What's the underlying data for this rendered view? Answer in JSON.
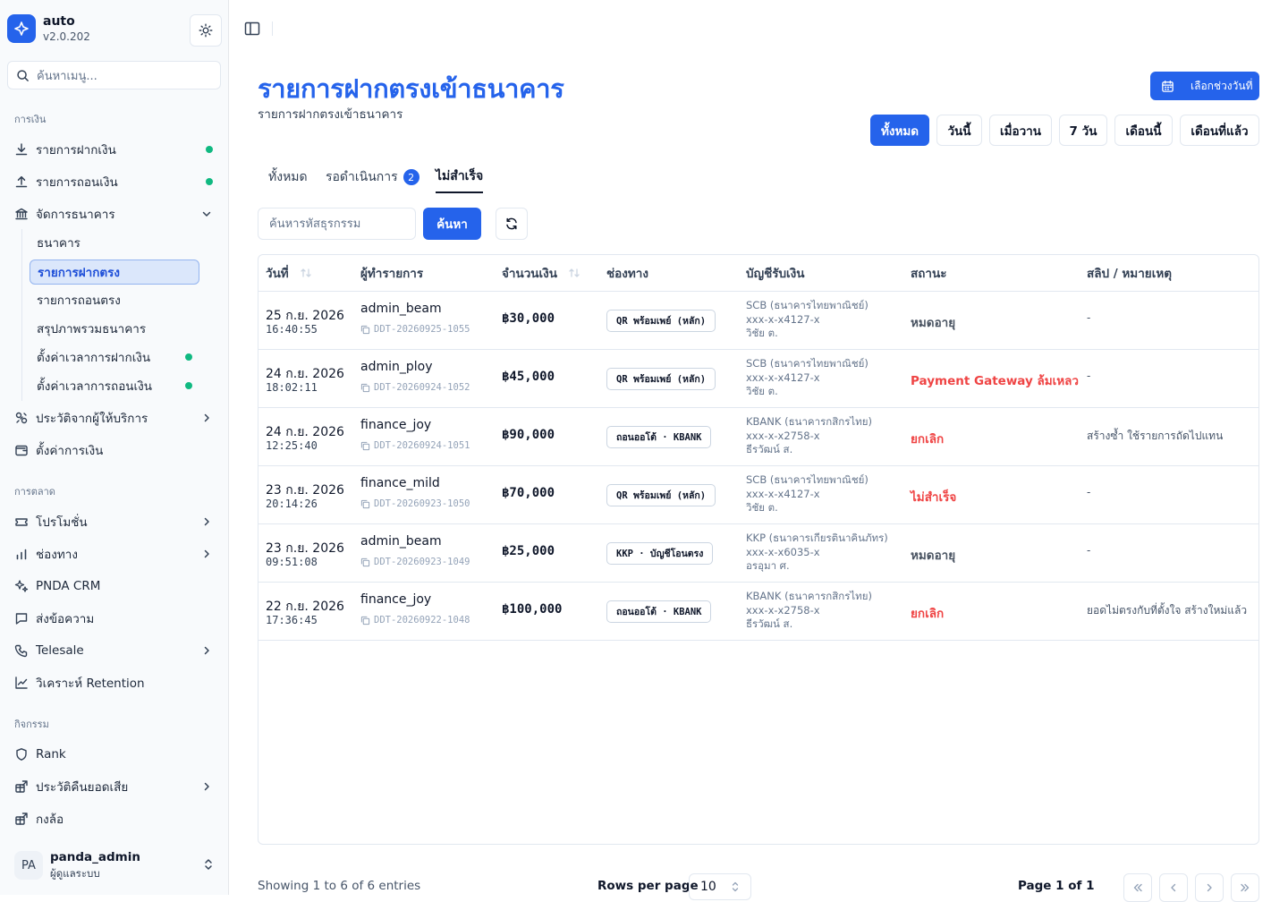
{
  "app": {
    "name": "auto",
    "version": "v2.0.202"
  },
  "sidebar": {
    "search_placeholder": "ค้นหาเมนู...",
    "groups": {
      "finance": "การเงิน",
      "marketing": "การตลาด",
      "activity": "กิจกรรม"
    },
    "items": {
      "deposit": "รายการฝากเงิน",
      "withdraw": "รายการถอนเงิน",
      "bank_mgmt": "จัดการธนาคาร",
      "provider_history": "ประวัติจากผู้ให้บริการ",
      "finance_settings": "ตั้งค่าการเงิน",
      "promotion": "โปรโมชั่น",
      "channel": "ช่องทาง",
      "crm": "PNDA CRM",
      "message": "ส่งข้อความ",
      "telesale": "Telesale",
      "retention": "วิเคราะห์ Retention",
      "rank": "Rank",
      "cashback": "ประวัติคืนยอดเสีย",
      "box": "กงล้อ"
    },
    "bank_sub": {
      "bank": "ธนาคาร",
      "direct_deposit": "รายการฝากตรง",
      "direct_withdraw": "รายการถอนตรง",
      "bank_summary": "สรุปภาพรวมธนาคาร",
      "deposit_time": "ตั้งค่าเวลาการฝากเงิน",
      "withdraw_time": "ตั้งค่าเวลาการถอนเงิน"
    },
    "status_color": "#10b981"
  },
  "user": {
    "initials": "PA",
    "name": "panda_admin",
    "role": "ผู้ดูแลระบบ"
  },
  "page": {
    "title": "รายการฝากตรงเข้าธนาคาร",
    "subtitle": "รายการฝากตรงเข้าธนาคาร",
    "date_button": "เลือกช่วงวันที่",
    "ranges": [
      "ทั้งหมด",
      "วันนี้",
      "เมื่อวาน",
      "7 วัน",
      "เดือนนี้",
      "เดือนที่แล้ว"
    ],
    "active_range": "ทั้งหมด",
    "tabs": [
      {
        "label": "ทั้งหมด"
      },
      {
        "label": "รอดำเนินการ",
        "badge": "2"
      },
      {
        "label": "ไม่สำเร็จ"
      }
    ],
    "active_tab": "ไม่สำเร็จ",
    "search_placeholder": "ค้นหารหัสธุรกรรม",
    "search_button": "ค้นหา",
    "accent": "#2563eb"
  },
  "table": {
    "columns": [
      "วันที่",
      "ผู้ทำรายการ",
      "จำนวนเงิน",
      "ช่องทาง",
      "บัญชีรับเงิน",
      "สถานะ",
      "สลิป / หมายเหตุ"
    ],
    "rows": [
      {
        "date": "25 ก.ย. 2026",
        "time": "16:40:55",
        "user": "admin_beam",
        "ref": "DDT-20260925-1055",
        "amount": "฿30,000",
        "channel": "QR พร้อมเพย์ (หลัก)",
        "acc_bank": "SCB (ธนาคารไทยพาณิชย์)",
        "acc_no": "xxx-x-x4127-x",
        "acc_name": "วิชัย ต.",
        "status": "หมดอายุ",
        "status_color": "#4b5563",
        "note": "-"
      },
      {
        "date": "24 ก.ย. 2026",
        "time": "18:02:11",
        "user": "admin_ploy",
        "ref": "DDT-20260924-1052",
        "amount": "฿45,000",
        "channel": "QR พร้อมเพย์ (หลัก)",
        "acc_bank": "SCB (ธนาคารไทยพาณิชย์)",
        "acc_no": "xxx-x-x4127-x",
        "acc_name": "วิชัย ต.",
        "status": "Payment Gateway ล้มเหลว",
        "status_color": "#ef4444",
        "note": "-"
      },
      {
        "date": "24 ก.ย. 2026",
        "time": "12:25:40",
        "user": "finance_joy",
        "ref": "DDT-20260924-1051",
        "amount": "฿90,000",
        "channel": "ถอนออโต้ · KBANK",
        "acc_bank": "KBANK (ธนาคารกสิกรไทย)",
        "acc_no": "xxx-x-x2758-x",
        "acc_name": "ธีรวัฒน์ ส.",
        "status": "ยกเลิก",
        "status_color": "#ef4444",
        "note": "สร้างซ้ำ ใช้รายการถัดไปแทน"
      },
      {
        "date": "23 ก.ย. 2026",
        "time": "20:14:26",
        "user": "finance_mild",
        "ref": "DDT-20260923-1050",
        "amount": "฿70,000",
        "channel": "QR พร้อมเพย์ (หลัก)",
        "acc_bank": "SCB (ธนาคารไทยพาณิชย์)",
        "acc_no": "xxx-x-x4127-x",
        "acc_name": "วิชัย ต.",
        "status": "ไม่สำเร็จ",
        "status_color": "#ef4444",
        "note": "-"
      },
      {
        "date": "23 ก.ย. 2026",
        "time": "09:51:08",
        "user": "admin_beam",
        "ref": "DDT-20260923-1049",
        "amount": "฿25,000",
        "channel": "KKP · บัญชีโอนตรง",
        "acc_bank": "KKP (ธนาคารเกียรตินาคินภัทร)",
        "acc_no": "xxx-x-x6035-x",
        "acc_name": "อรอุมา ศ.",
        "status": "หมดอายุ",
        "status_color": "#4b5563",
        "note": "-"
      },
      {
        "date": "22 ก.ย. 2026",
        "time": "17:36:45",
        "user": "finance_joy",
        "ref": "DDT-20260922-1048",
        "amount": "฿100,000",
        "channel": "ถอนออโต้ · KBANK",
        "acc_bank": "KBANK (ธนาคารกสิกรไทย)",
        "acc_no": "xxx-x-x2758-x",
        "acc_name": "ธีรวัฒน์ ส.",
        "status": "ยกเลิก",
        "status_color": "#ef4444",
        "note": "ยอดไม่ตรงกับที่ตั้งใจ สร้างใหม่แล้ว"
      }
    ]
  },
  "pagination": {
    "showing": "Showing 1 to 6 of 6 entries",
    "rows_per_page_label": "Rows per page",
    "rows_per_page": "10",
    "page_info": "Page 1 of 1"
  }
}
